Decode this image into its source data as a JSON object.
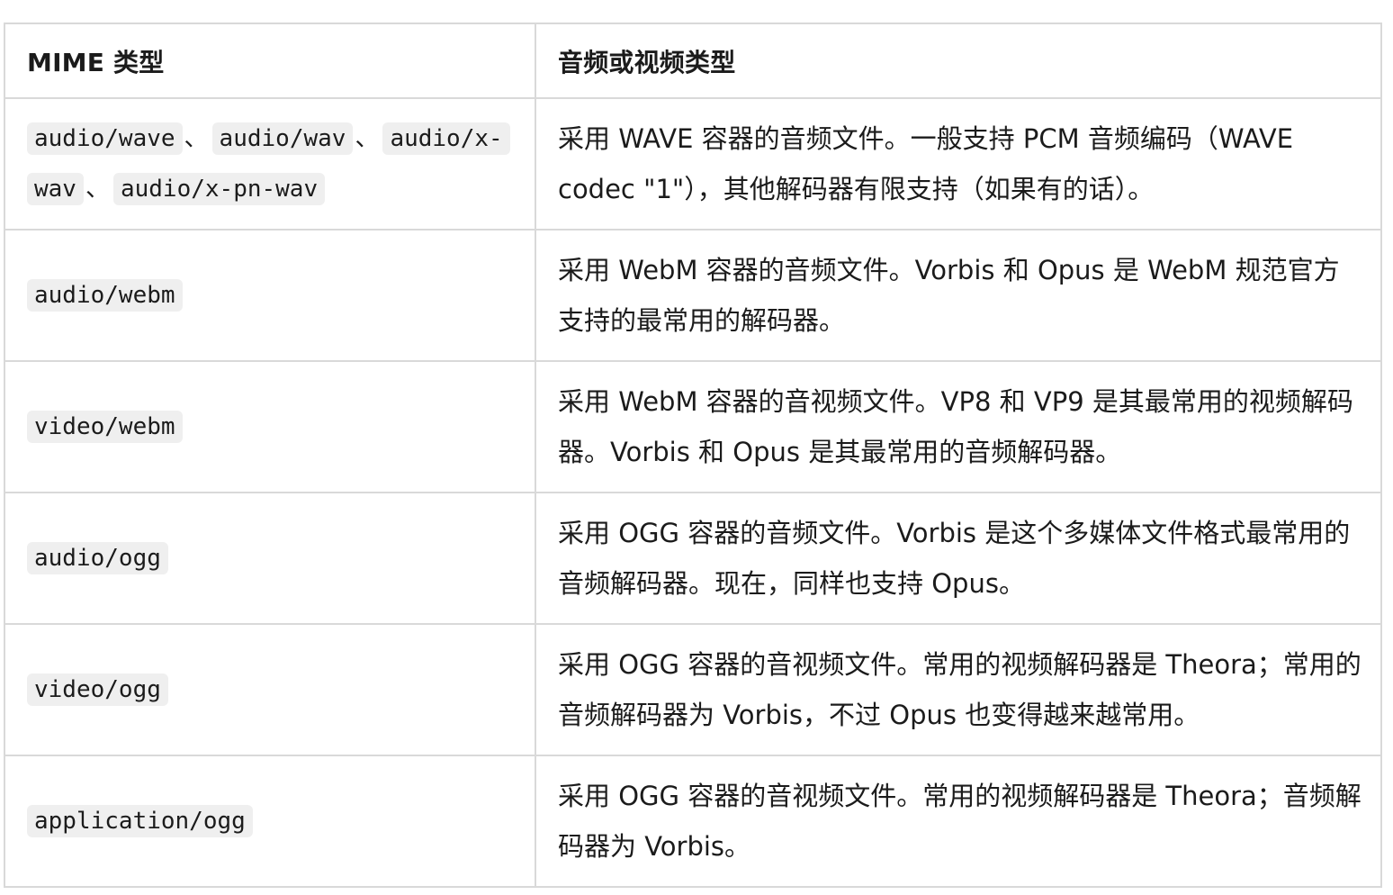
{
  "table": {
    "headers": {
      "mime": "MIME 类型",
      "desc": "音频或视频类型"
    },
    "rows": [
      {
        "mime": [
          "audio/wave",
          "audio/wav",
          "audio/x-wav",
          "audio/x-pn-wav"
        ],
        "separator": "、",
        "description": "采用 WAVE 容器的音频文件。一般支持 PCM 音频编码（WAVE codec \"1\"），其他解码器有限支持（如果有的话）。"
      },
      {
        "mime": [
          "audio/webm"
        ],
        "description": "采用 WebM 容器的音频文件。Vorbis 和 Opus 是 WebM 规范官方支持的最常用的解码器。"
      },
      {
        "mime": [
          "video/webm"
        ],
        "description": "采用 WebM 容器的音视频文件。VP8 和 VP9 是其最常用的视频解码器。Vorbis 和 Opus 是其最常用的音频解码器。"
      },
      {
        "mime": [
          "audio/ogg"
        ],
        "description": "采用 OGG 容器的音频文件。Vorbis 是这个多媒体文件格式最常用的音频解码器。现在，同样也支持 Opus。"
      },
      {
        "mime": [
          "video/ogg"
        ],
        "description": "采用 OGG 容器的音视频文件。常用的视频解码器是 Theora；常用的音频解码器为 Vorbis，不过 Opus 也变得越来越常用。"
      },
      {
        "mime": [
          "application/ogg"
        ],
        "description": "采用 OGG 容器的音视频文件。常用的视频解码器是 Theora；音频解码器为 Vorbis。"
      }
    ]
  }
}
